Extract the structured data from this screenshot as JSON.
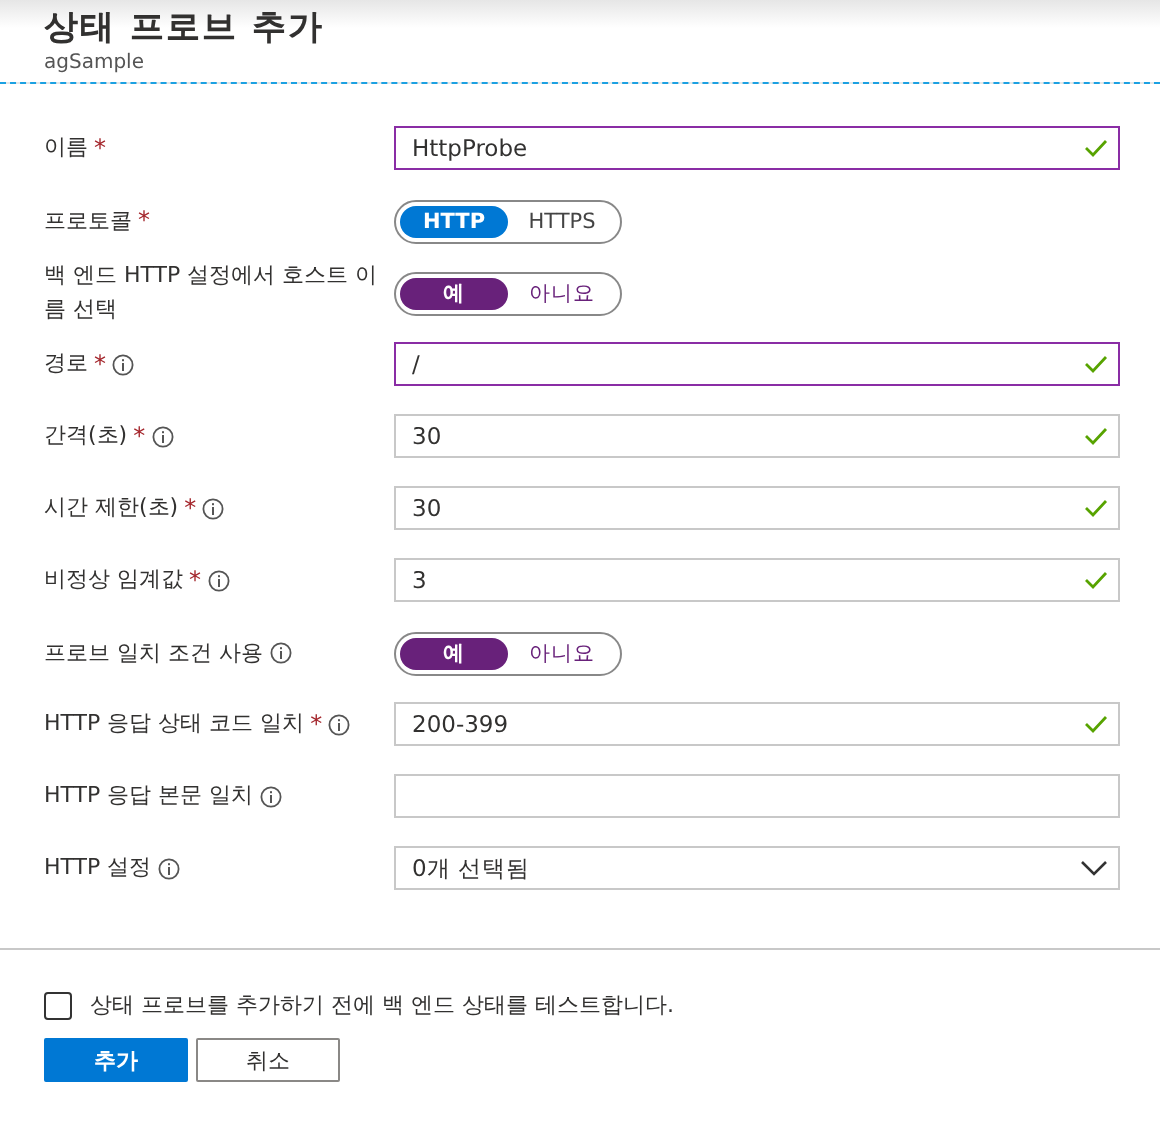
{
  "header": {
    "title": "상태 프로브 추가",
    "subtitle": "agSample"
  },
  "fields": [
    {
      "kind": "text",
      "label": "이름",
      "required_mark": "*",
      "info": false,
      "value": "HttpProbe",
      "valid": true,
      "focused": true
    },
    {
      "kind": "toggle",
      "label": "프로토콜",
      "required_mark": "*",
      "info": false,
      "color": "#0078d4",
      "options": [
        {
          "label": "HTTP",
          "selected": true
        },
        {
          "label": "HTTPS",
          "selected": false
        }
      ]
    },
    {
      "kind": "toggle",
      "label": "백 엔드 HTTP 설정에서 호스트 이름 선택",
      "info": false,
      "color": "#68217a",
      "options": [
        {
          "label": "예",
          "selected": true
        },
        {
          "label": "아니요",
          "selected": false
        }
      ]
    },
    {
      "kind": "text",
      "label": "경로",
      "required_mark": "*",
      "info": true,
      "value": "/",
      "valid": true,
      "focused": true
    },
    {
      "kind": "text",
      "label": "간격(초)",
      "required_mark": "*",
      "info": true,
      "value": "30",
      "valid": true,
      "focused": false
    },
    {
      "kind": "text",
      "label": "시간 제한(초)",
      "required_mark": "*",
      "info": true,
      "value": "30",
      "valid": true,
      "focused": false
    },
    {
      "kind": "text",
      "label": "비정상 임계값",
      "required_mark": "*",
      "info": true,
      "value": "3",
      "valid": true,
      "focused": false
    },
    {
      "kind": "toggle",
      "label": "프로브 일치 조건 사용",
      "info": true,
      "color": "#68217a",
      "options": [
        {
          "label": "예",
          "selected": true
        },
        {
          "label": "아니요",
          "selected": false
        }
      ]
    },
    {
      "kind": "text",
      "label": "HTTP 응답 상태 코드 일치",
      "required_mark": "*",
      "info": true,
      "value": "200-399",
      "valid": true,
      "focused": false
    },
    {
      "kind": "text",
      "label": "HTTP 응답 본문 일치",
      "info": true,
      "valid": false,
      "focused": false
    },
    {
      "kind": "select",
      "label": "HTTP 설정",
      "info": true,
      "value": "0개 선택됨"
    }
  ],
  "test_checkbox": {
    "label": "상태 프로브를 추가하기 전에 백 엔드 상태를 테스트합니다.",
    "checked": false
  },
  "buttons": [
    {
      "label": "추가",
      "primary": true
    },
    {
      "label": "취소",
      "primary": false
    }
  ]
}
